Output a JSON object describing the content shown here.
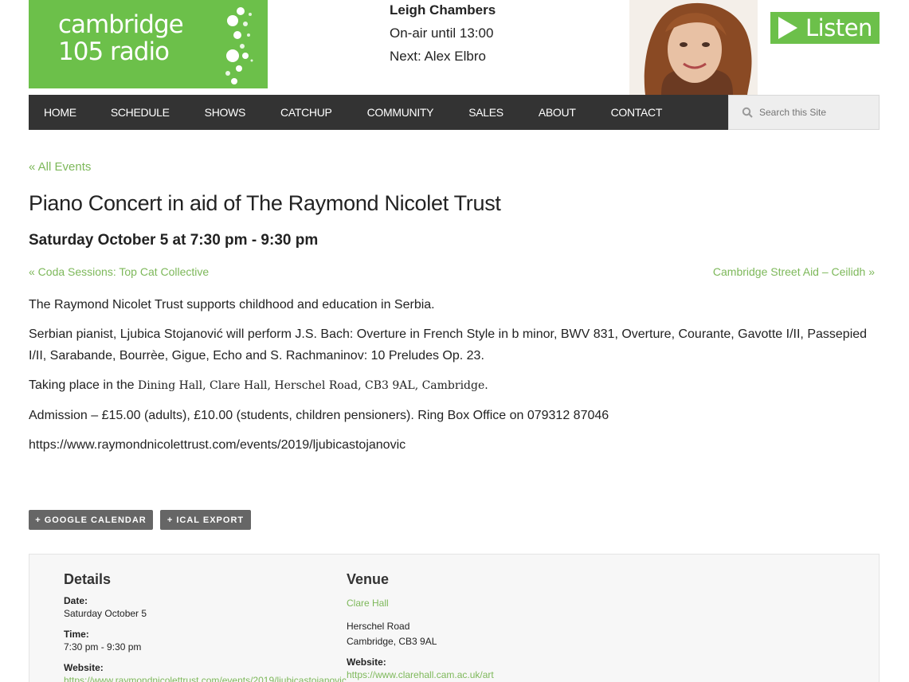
{
  "logo": {
    "line1": "cambridge",
    "line2": "105 radio",
    "colors": {
      "brand": "#6cc04a"
    }
  },
  "on_air": {
    "host": "Leigh Chambers",
    "until": "On-air until 13:00",
    "next": "Next: Alex Elbro"
  },
  "listen_button": {
    "label": "Listen",
    "icon": "play-icon"
  },
  "nav": {
    "items": [
      "HOME",
      "SCHEDULE",
      "SHOWS",
      "CATCHUP",
      "COMMUNITY",
      "SALES",
      "ABOUT",
      "CONTACT"
    ],
    "background": "#333333"
  },
  "search": {
    "placeholder": "Search this Site",
    "icon": "search-icon"
  },
  "event": {
    "back_link": "« All Events",
    "title": "Piano Concert in aid of The Raymond Nicolet Trust",
    "datetime": "Saturday October 5 at 7:30 pm - 9:30 pm",
    "prev_link": "« Coda Sessions: Top Cat Collective",
    "next_link": "Cambridge Street Aid – Ceilidh »",
    "paragraph1": "The Raymond Nicolet Trust supports childhood and education in Serbia.",
    "paragraph2": "Serbian pianist, Ljubica Stojanović will perform J.S. Bach: Overture in French Style in b minor, BWV 831, Overture, Courante, Gavotte I/II, Passepied I/II, Sarabande, Bourrèe, Gigue, Echo and S. Rachmaninov: 10 Preludes Op. 23.",
    "paragraph3_prefix": "Taking place in the ",
    "paragraph3_venue": "Dining Hall, Clare Hall, Herschel Road, CB3 9AL, Cambridge.",
    "paragraph4": "Admission – £15.00 (adults), £10.00 (students, children pensioners).  Ring Box Office on 079312 87046",
    "url": "https://www.raymondnicolettrust.com/events/2019/ljubicastojanovic"
  },
  "buttons": {
    "google_calendar": "+ GOOGLE CALENDAR",
    "ical_export": "+ ICAL EXPORT"
  },
  "details": {
    "heading": "Details",
    "date_label": "Date:",
    "date_value": "Saturday October 5",
    "time_label": "Time:",
    "time_value": "7:30 pm - 9:30 pm",
    "website_label": "Website:",
    "website_value": "https://www.raymondnicolettrust.com/events/2019/ljubicastojanovic"
  },
  "venue": {
    "heading": "Venue",
    "name": "Clare Hall",
    "address1": "Herschel Road",
    "address2": "Cambridge, CB3 9AL",
    "website_label": "Website:",
    "website_value": "https://www.clarehall.cam.ac.uk/art"
  },
  "colors": {
    "link_green": "#7db85a",
    "button_gray": "#666666"
  }
}
